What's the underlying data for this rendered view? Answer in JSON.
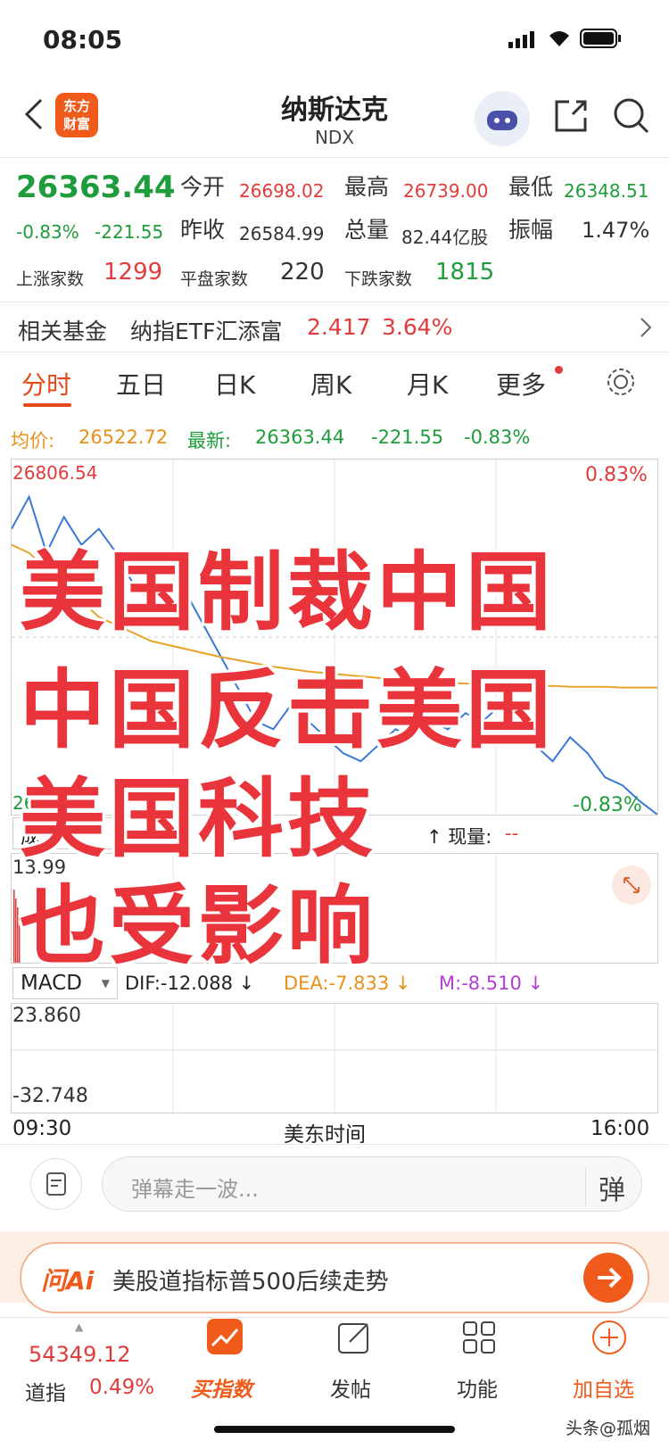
{
  "status": {
    "time": "08:05"
  },
  "header": {
    "title": "纳斯达克",
    "code": "NDX",
    "logo_text_1": "东方",
    "logo_text_2": "财富"
  },
  "quote": {
    "price": "26363.44",
    "change": "-0.83%",
    "change_abs": "-221.55",
    "open_label": "今开",
    "open": "26698.02",
    "high_label": "最高",
    "high": "26739.00",
    "low_label": "最低",
    "low": "26348.51",
    "prev_label": "昨收",
    "prev": "26584.99",
    "volume_label": "总量",
    "volume": "82.44亿股",
    "amp_label": "振幅",
    "amp": "1.47%",
    "up_label": "上涨家数",
    "up": "1299",
    "flat_label": "平盘家数",
    "flat": "220",
    "down_label": "下跌家数",
    "down": "1815"
  },
  "fund": {
    "label": "相关基金",
    "name": "纳指ETF汇添富",
    "price": "2.417",
    "change": "3.64%"
  },
  "tabs": [
    "分时",
    "五日",
    "日K",
    "周K",
    "月K",
    "更多"
  ],
  "price_bar": {
    "avg_label": "均价:",
    "avg": "26522.72",
    "last_label": "最新:",
    "last": "26363.44",
    "chg": "-221.55",
    "pct": "-0.83%"
  },
  "chart": {
    "top_value": "26806.54",
    "top_pct": "0.83%",
    "bottom_pct": "-0.83%",
    "bottom_value_partial": "26...",
    "volume_label_partial": "成交",
    "volume_now_label": "↑ 现量:",
    "volume_now": "--",
    "volume_max": "13.99",
    "macd_label": "MACD",
    "dif": "DIF:-12.088 ↓",
    "dea": "DEA:-7.833 ↓",
    "m": "M:-8.510 ↓",
    "macd_max": "23.860",
    "macd_min": "-32.748",
    "time_start": "09:30",
    "time_mid": "美东时间",
    "time_end": "16:00"
  },
  "chart_data": {
    "type": "line",
    "series": [
      {
        "name": "price",
        "values": [
          26720,
          26760,
          26690,
          26735,
          26700,
          26720,
          26690,
          26650,
          26630,
          26610,
          26640,
          26600,
          26560,
          26520,
          26480,
          26470,
          26500,
          26480,
          26460,
          26440,
          26430,
          26450,
          26470,
          26460,
          26480,
          26470,
          26490,
          26480,
          26500,
          26470,
          26450,
          26430,
          26460,
          26440,
          26410,
          26400,
          26380,
          26360
        ]
      },
      {
        "name": "avg",
        "values": [
          26700,
          26690,
          26670,
          26650,
          26630,
          26610,
          26600,
          26590,
          26580,
          26575,
          26570,
          26565,
          26560,
          26556,
          26552,
          26548,
          26545,
          26542,
          26540,
          26538,
          26536,
          26534,
          26532,
          26530,
          26529,
          26528,
          26527,
          26526,
          26525,
          26525,
          26524,
          26524,
          26523,
          26523,
          26523,
          26522,
          26522,
          26522
        ]
      }
    ],
    "ylim": [
      26363.44,
      26806.54
    ]
  },
  "overlay": {
    "line1": "美国制裁中国",
    "line2": "中国反击美国",
    "line3": "美国科技",
    "line4": "也受影响"
  },
  "danmu": {
    "placeholder": "弹幕走一波...",
    "send": "弹"
  },
  "ai": {
    "brand": "问Ai",
    "text": "美股道指标普500后续走势"
  },
  "bottom_nav": {
    "index_value": "54349.12",
    "index_name": "道指",
    "index_pct": "0.49%",
    "buy_label": "买指数",
    "post_label": "发帖",
    "func_label": "功能",
    "add_label": "加自选"
  },
  "watermark": "头条@孤烟"
}
